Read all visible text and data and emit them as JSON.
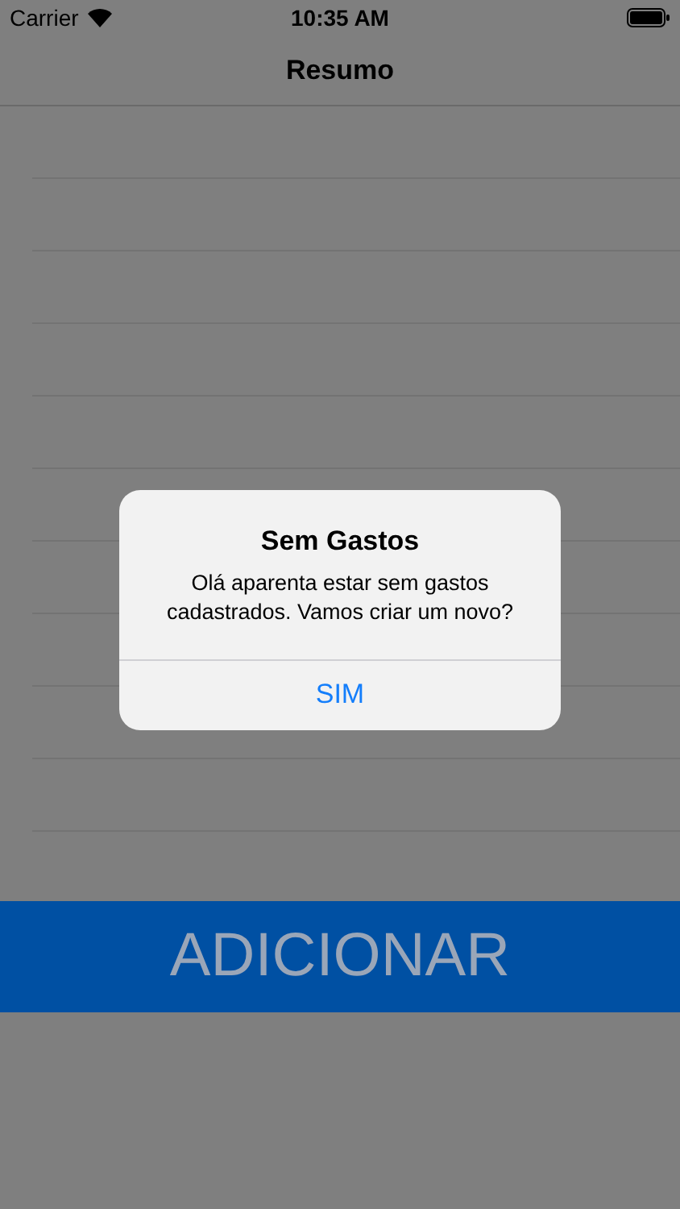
{
  "status_bar": {
    "carrier": "Carrier",
    "time": "10:35 AM"
  },
  "nav": {
    "title": "Resumo"
  },
  "alert": {
    "title": "Sem Gastos",
    "message": "Olá aparenta estar sem gastos cadastrados. Vamos criar um novo?",
    "buttons": [
      "SIM"
    ]
  },
  "add_button": {
    "label": "ADICIONAR"
  }
}
